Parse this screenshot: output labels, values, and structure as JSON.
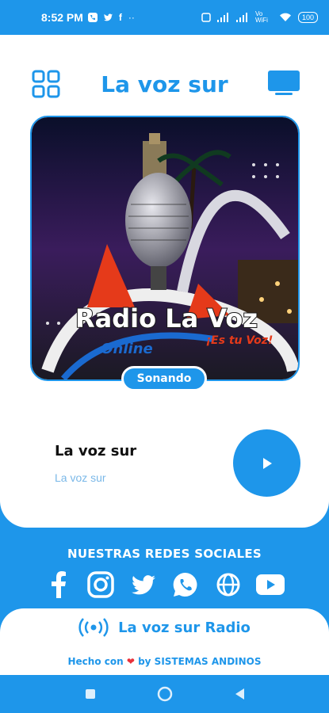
{
  "status_bar": {
    "time": "8:52 PM",
    "left_icons": [
      "phone-icon",
      "twitter-icon",
      "facebook-icon",
      "more-icon"
    ],
    "network": "Vo WiFi",
    "battery": "100"
  },
  "header": {
    "title": "La voz sur",
    "menu_icon": "grid-icon",
    "cast_icon": "tv-icon"
  },
  "cover": {
    "brand": "Radio La Voz",
    "online": "Online",
    "slogan": "¡Es tu Voz!"
  },
  "player": {
    "status_badge": "Sonando",
    "track_title": "La voz sur",
    "track_subtitle": "La voz sur",
    "play_icon": "play-icon"
  },
  "social": {
    "heading": "NUESTRAS REDES SOCIALES",
    "icons": [
      "facebook-icon",
      "instagram-icon",
      "twitter-icon",
      "whatsapp-icon",
      "web-icon",
      "youtube-icon"
    ]
  },
  "footer": {
    "radio_label": "La voz sur Radio",
    "made_with_prefix": "Hecho con",
    "made_with_suffix": "by SISTEMAS ANDINOS"
  },
  "colors": {
    "primary": "#1e96ea",
    "heart": "#e8313a"
  }
}
